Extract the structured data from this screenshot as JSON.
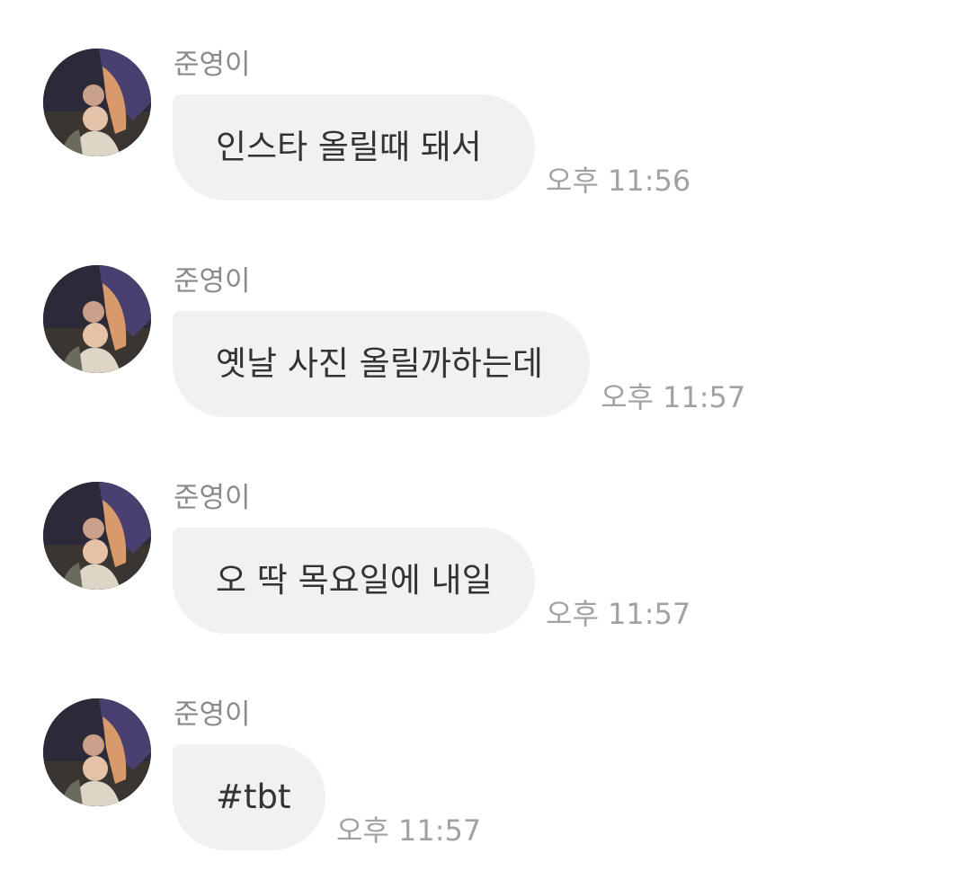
{
  "messages": [
    {
      "sender": "준영이",
      "text": "인스타 올릴때 돼서",
      "time": "오후 11:56"
    },
    {
      "sender": "준영이",
      "text": "옛날 사진 올릴까하는데",
      "time": "오후 11:57"
    },
    {
      "sender": "준영이",
      "text": "오 딱 목요일에 내일",
      "time": "오후 11:57"
    },
    {
      "sender": "준영이",
      "text": "#tbt",
      "time": "오후 11:57"
    }
  ],
  "colors": {
    "bubble_bg": "#f1f1f3",
    "sender": "#8a8a8e",
    "time": "#a2a2a6",
    "text": "#333333"
  },
  "icons": {
    "avatar": "profile-photo"
  }
}
